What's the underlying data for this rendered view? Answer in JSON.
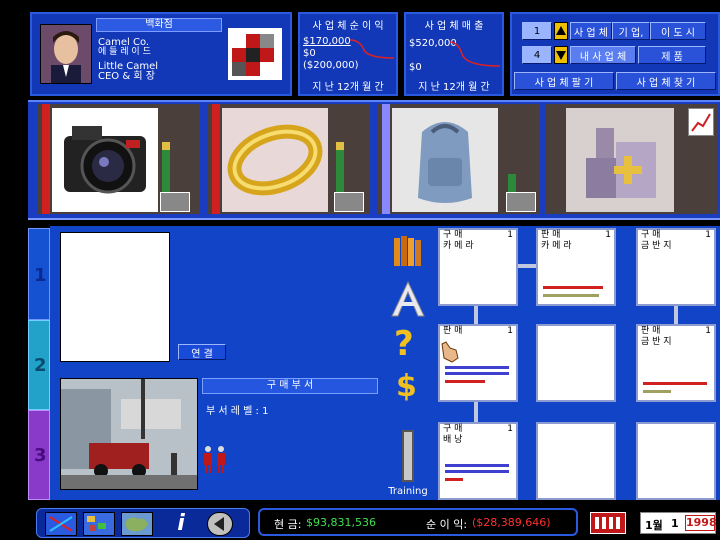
{
  "header": {
    "company_label": "백화점",
    "company_name": "Camel Co.",
    "company_name_kr": "에 들 레 이 드",
    "ceo_line1": "Little Camel",
    "ceo_line2": "CEO & 회 장",
    "profit_title": "사 업 체 순 이 익",
    "profit_high": "$170,000",
    "profit_zero": "$0",
    "profit_low": "($200,000)",
    "profit_period": "지 난  12개 월 간",
    "sales_title": "사 업 체 매 출",
    "sales_high": "$520,000",
    "sales_zero": "$0",
    "sales_period": "지 난  12개 월 간"
  },
  "nav": {
    "num_top": "1",
    "num_bottom": "4",
    "btn_business": "사 업 체",
    "btn_company": "기 업,",
    "btn_city": "이 도 시",
    "btn_my_business": "내 사 업 체",
    "btn_product": "제 품",
    "btn_sell": "사 업 체 팔 기",
    "btn_find": "사 업 체 찾 기"
  },
  "products": [
    {
      "name": "camera",
      "icon": "camera-icon"
    },
    {
      "name": "gold-ring",
      "icon": "ring-icon"
    },
    {
      "name": "backpack",
      "icon": "backpack-icon"
    },
    {
      "name": "cosmetics",
      "icon": "cosmetics-icon"
    }
  ],
  "left_tabs": [
    "1",
    "2",
    "3"
  ],
  "link_button": "연 결",
  "department": {
    "title": "구 매 부 서",
    "level_label": "부 서 레 벨 : 1"
  },
  "tools": {
    "training": "Training",
    "help": "?",
    "dollar": "$"
  },
  "units": [
    {
      "type": "구 매",
      "level": "1",
      "product": "카 메 라"
    },
    {
      "type": "판 매",
      "level": "1",
      "product": "카 메 라"
    },
    {
      "type": "구 매",
      "level": "1",
      "product": "금 반 지"
    },
    {
      "type": "판 매",
      "level": "1",
      "product": ""
    },
    {
      "type": "",
      "level": "",
      "product": ""
    },
    {
      "type": "판 매",
      "level": "1",
      "product": "금 반 지"
    },
    {
      "type": "구 매",
      "level": "1",
      "product": "배 낭"
    },
    {
      "type": "",
      "level": "",
      "product": ""
    },
    {
      "type": "",
      "level": "",
      "product": ""
    }
  ],
  "status": {
    "cash_label": "현 금:",
    "cash_value": "$93,831,536",
    "profit_label": "순 이 익:",
    "profit_value": "($28,389,646)",
    "month": "1월",
    "day": "1",
    "year": "1998"
  },
  "colors": {
    "panel_blue": "#1238b8",
    "cash_green": "#3fe050",
    "loss_red": "#ff3030"
  }
}
